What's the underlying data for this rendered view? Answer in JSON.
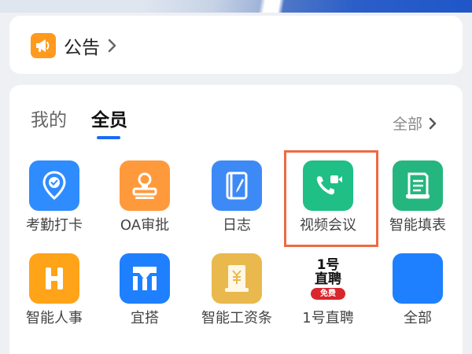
{
  "notice": {
    "label": "公告",
    "icon": "megaphone-icon",
    "icon_color": "#ff9a1f"
  },
  "tabs": {
    "mine": "我的",
    "all": "全员",
    "accent": "#1b6cf2"
  },
  "all_link": {
    "label": "全部"
  },
  "apps": [
    {
      "label": "考勤打卡",
      "icon": "location-pin-icon",
      "color": "#2f8cff"
    },
    {
      "label": "OA审批",
      "icon": "stamp-icon",
      "color": "#ff9a3c"
    },
    {
      "label": "日志",
      "icon": "notebook-icon",
      "color": "#3d8af7"
    },
    {
      "label": "视频会议",
      "icon": "video-call-icon",
      "color": "#1fbf85"
    },
    {
      "label": "智能填表",
      "icon": "form-icon",
      "color": "#25b67f"
    },
    {
      "label": "智能人事",
      "icon": "h-logo-icon",
      "color": "#ffa318"
    },
    {
      "label": "宜搭",
      "icon": "yida-logo-icon",
      "color": "#1e80ff"
    },
    {
      "label": "智能工资条",
      "icon": "salary-slip-icon",
      "color": "#e9b94e"
    },
    {
      "label": "1号直聘",
      "icon": "zhipin-logo-icon",
      "color": "#d8262c",
      "logo_top": "1号",
      "logo_mid": "直聘",
      "logo_badge": "免费"
    },
    {
      "label": "全部",
      "icon": "all-apps-icon",
      "color": "#1e80ff"
    }
  ],
  "highlight_color": "#ee6a43"
}
